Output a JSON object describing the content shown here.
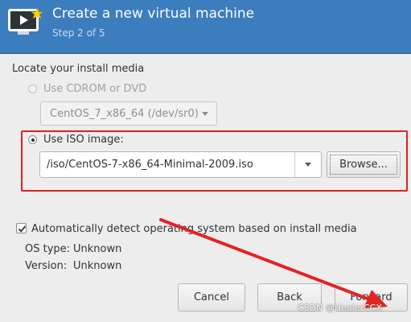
{
  "header": {
    "title": "Create a new virtual machine",
    "step": "Step 2 of 5",
    "icon": "monitor-play-star-icon"
  },
  "install_media": {
    "section_title": "Locate your install media",
    "cdrom_option": {
      "label": "Use CDROM or DVD",
      "selected": false,
      "disabled": true
    },
    "cdrom_device": "CentOS_7_x86_64 (/dev/sr0)",
    "iso_option": {
      "label": "Use ISO image:",
      "selected": true
    },
    "iso_path": "/iso/CentOS-7-x86_64-Minimal-2009.iso",
    "browse_label": "Browse..."
  },
  "os_detection": {
    "auto_detect_label": "Automatically detect operating system based on install media",
    "auto_detect_checked": true,
    "os_type_label": "OS type:",
    "os_type_value": "Unknown",
    "version_label": "Version:",
    "version_value": "Unknown"
  },
  "buttons": {
    "cancel": "Cancel",
    "back": "Back",
    "forward": "Forward"
  },
  "annotations": {
    "highlight_color": "#e02020",
    "watermark": "CSDN @HealerCCX"
  },
  "colors": {
    "header_bg": "#3c7dbe",
    "window_bg": "#ededed"
  }
}
